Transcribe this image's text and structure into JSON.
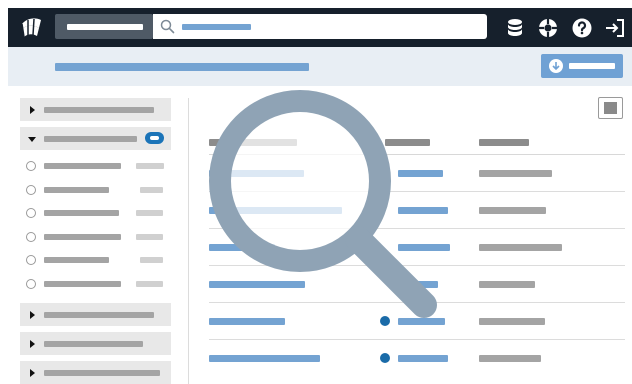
{
  "app": {
    "logo_icon": "globe-logo-icon",
    "scope_select": {
      "value": ""
    },
    "search": {
      "placeholder": "",
      "icon": "search-icon"
    },
    "toolbar_icons": [
      "database-icon",
      "support-lifebuoy-icon",
      "help-icon",
      "sign-out-icon"
    ]
  },
  "subheader": {
    "title": "",
    "export_button": {
      "label": "",
      "icon": "download-icon"
    }
  },
  "sidebar": {
    "groups_before": [
      {
        "label": "",
        "expanded": false
      }
    ],
    "expanded_group": {
      "label": "",
      "badge": "",
      "items": [
        {
          "label": "",
          "count": ""
        },
        {
          "label": "",
          "count": ""
        },
        {
          "label": "",
          "count": ""
        },
        {
          "label": "",
          "count": ""
        },
        {
          "label": "",
          "count": ""
        },
        {
          "label": "",
          "count": ""
        }
      ]
    },
    "groups_after": [
      {
        "label": "",
        "expanded": false
      },
      {
        "label": "",
        "expanded": false
      },
      {
        "label": "",
        "expanded": false
      }
    ]
  },
  "table": {
    "headers": [
      "",
      "",
      ""
    ],
    "rows": [
      {
        "name": "",
        "status_dot": false,
        "type": "",
        "value": ""
      },
      {
        "name": "",
        "status_dot": false,
        "type": "",
        "value": ""
      },
      {
        "name": "",
        "status_dot": false,
        "type": "",
        "value": ""
      },
      {
        "name": "",
        "status_dot": false,
        "type": "",
        "value": ""
      },
      {
        "name": "",
        "status_dot": true,
        "type": "",
        "value": ""
      },
      {
        "name": "",
        "status_dot": true,
        "type": "",
        "value": ""
      }
    ]
  },
  "overlay": {
    "icon": "magnifying-glass-icon"
  },
  "colors": {
    "topbar": "#16202c",
    "accent": "#74a3d2",
    "button": "#6fa1d4",
    "badge": "#1b74b8",
    "status_dot": "#1a6ba8",
    "magnifier": "#8fa3b5",
    "subheader_bg": "#e8eef4"
  }
}
